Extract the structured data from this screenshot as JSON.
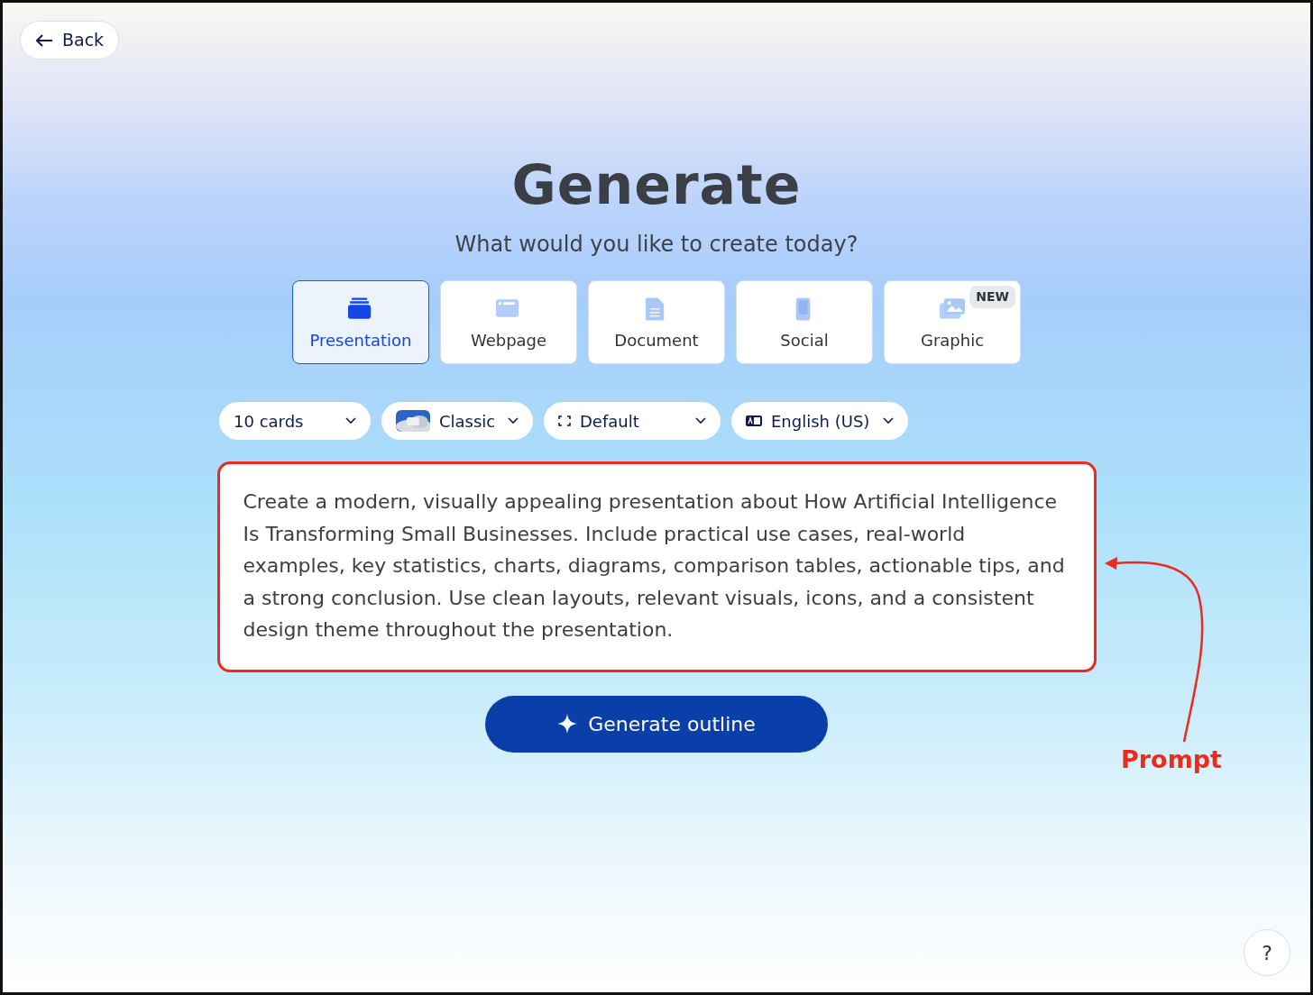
{
  "back_button": {
    "label": "Back"
  },
  "title": "Generate",
  "subtitle": "What would you like to create today?",
  "types": [
    {
      "label": "Presentation",
      "selected": true
    },
    {
      "label": "Webpage",
      "selected": false
    },
    {
      "label": "Document",
      "selected": false
    },
    {
      "label": "Social",
      "selected": false
    },
    {
      "label": "Graphic",
      "selected": false,
      "badge": "NEW"
    }
  ],
  "options": [
    {
      "label": "10 cards"
    },
    {
      "label": "Classic"
    },
    {
      "label": "Default"
    },
    {
      "label": "English (US)"
    }
  ],
  "prompt": {
    "value": "Create a modern, visually appealing presentation about How Artificial Intelligence Is Transforming Small Businesses. Include practical use cases, real-world examples, key statistics, charts, diagrams, comparison tables, actionable tips, and a strong conclusion. Use clean layouts, relevant visuals, icons, and a consistent design theme throughout the presentation."
  },
  "generate_button": {
    "label": "Generate outline"
  },
  "annotation": {
    "label": "Prompt"
  },
  "help_button": {
    "label": "?"
  }
}
